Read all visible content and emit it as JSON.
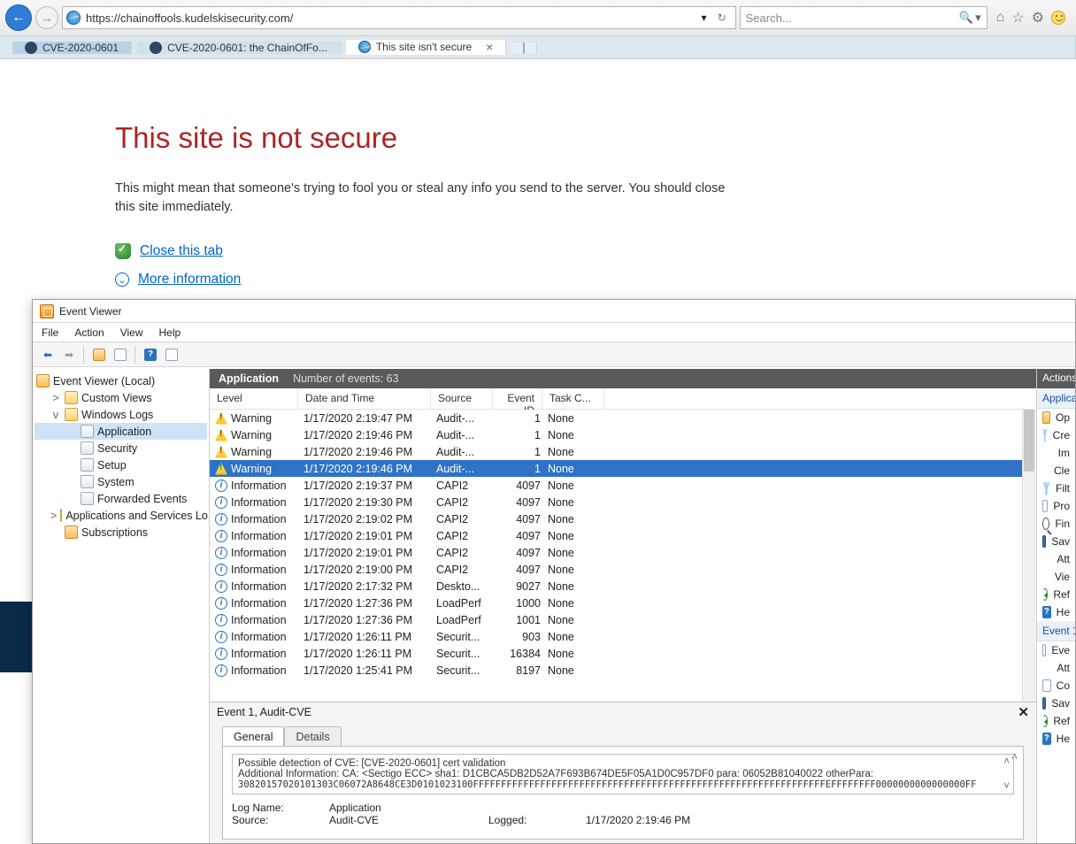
{
  "browser": {
    "url": "https://chainoffools.kudelskisecurity.com/",
    "refresh_glyph": "↻",
    "dropdown_glyph": "▾",
    "search_placeholder": "Search...",
    "search_icon": "🔍",
    "tabs": [
      {
        "label": "CVE-2020-0601",
        "active": false
      },
      {
        "label": "CVE-2020-0601: the ChainOfFo...",
        "active": false
      },
      {
        "label": "This site isn't secure",
        "active": true
      }
    ]
  },
  "error_page": {
    "title": "This site is not secure",
    "message": "This might mean that someone's trying to fool you or steal any info you send to the server. You should close this site immediately.",
    "close_link": "Close this tab",
    "more_link": "More information"
  },
  "event_viewer": {
    "window_title": "Event Viewer",
    "menu": [
      "File",
      "Action",
      "View",
      "Help"
    ],
    "tree": {
      "root": "Event Viewer (Local)",
      "items": [
        {
          "label": "Custom Views",
          "expand": ">",
          "indent": 1,
          "icon": "folder"
        },
        {
          "label": "Windows Logs",
          "expand": "v",
          "indent": 1,
          "icon": "folder"
        },
        {
          "label": "Application",
          "indent": 2,
          "icon": "log",
          "selected": true
        },
        {
          "label": "Security",
          "indent": 2,
          "icon": "log"
        },
        {
          "label": "Setup",
          "indent": 2,
          "icon": "log"
        },
        {
          "label": "System",
          "indent": 2,
          "icon": "log"
        },
        {
          "label": "Forwarded Events",
          "indent": 2,
          "icon": "log"
        },
        {
          "label": "Applications and Services Lo",
          "expand": ">",
          "indent": 1,
          "icon": "folder"
        },
        {
          "label": "Subscriptions",
          "indent": 1,
          "icon": "orange"
        }
      ]
    },
    "list": {
      "header_label": "Application",
      "count_label": "Number of events: 63",
      "columns": [
        "Level",
        "Date and Time",
        "Source",
        "Event ID",
        "Task C..."
      ],
      "rows": [
        {
          "level": "Warning",
          "icon": "warn",
          "dt": "1/17/2020 2:19:47 PM",
          "src": "Audit-...",
          "eid": "1",
          "tc": "None"
        },
        {
          "level": "Warning",
          "icon": "warn",
          "dt": "1/17/2020 2:19:46 PM",
          "src": "Audit-...",
          "eid": "1",
          "tc": "None"
        },
        {
          "level": "Warning",
          "icon": "warn",
          "dt": "1/17/2020 2:19:46 PM",
          "src": "Audit-...",
          "eid": "1",
          "tc": "None"
        },
        {
          "level": "Warning",
          "icon": "warn",
          "dt": "1/17/2020 2:19:46 PM",
          "src": "Audit-...",
          "eid": "1",
          "tc": "None",
          "selected": true
        },
        {
          "level": "Information",
          "icon": "info",
          "dt": "1/17/2020 2:19:37 PM",
          "src": "CAPI2",
          "eid": "4097",
          "tc": "None"
        },
        {
          "level": "Information",
          "icon": "info",
          "dt": "1/17/2020 2:19:30 PM",
          "src": "CAPI2",
          "eid": "4097",
          "tc": "None"
        },
        {
          "level": "Information",
          "icon": "info",
          "dt": "1/17/2020 2:19:02 PM",
          "src": "CAPI2",
          "eid": "4097",
          "tc": "None"
        },
        {
          "level": "Information",
          "icon": "info",
          "dt": "1/17/2020 2:19:01 PM",
          "src": "CAPI2",
          "eid": "4097",
          "tc": "None"
        },
        {
          "level": "Information",
          "icon": "info",
          "dt": "1/17/2020 2:19:01 PM",
          "src": "CAPI2",
          "eid": "4097",
          "tc": "None"
        },
        {
          "level": "Information",
          "icon": "info",
          "dt": "1/17/2020 2:19:00 PM",
          "src": "CAPI2",
          "eid": "4097",
          "tc": "None"
        },
        {
          "level": "Information",
          "icon": "info",
          "dt": "1/17/2020 2:17:32 PM",
          "src": "Deskto...",
          "eid": "9027",
          "tc": "None"
        },
        {
          "level": "Information",
          "icon": "info",
          "dt": "1/17/2020 1:27:36 PM",
          "src": "LoadPerf",
          "eid": "1000",
          "tc": "None"
        },
        {
          "level": "Information",
          "icon": "info",
          "dt": "1/17/2020 1:27:36 PM",
          "src": "LoadPerf",
          "eid": "1001",
          "tc": "None"
        },
        {
          "level": "Information",
          "icon": "info",
          "dt": "1/17/2020 1:26:11 PM",
          "src": "Securit...",
          "eid": "903",
          "tc": "None"
        },
        {
          "level": "Information",
          "icon": "info",
          "dt": "1/17/2020 1:26:11 PM",
          "src": "Securit...",
          "eid": "16384",
          "tc": "None"
        },
        {
          "level": "Information",
          "icon": "info",
          "dt": "1/17/2020 1:25:41 PM",
          "src": "Securit...",
          "eid": "8197",
          "tc": "None"
        }
      ]
    },
    "detail": {
      "title": "Event 1, Audit-CVE",
      "tabs": [
        "General",
        "Details"
      ],
      "description_l1": "Possible detection of CVE: [CVE-2020-0601] cert validation",
      "description_l2": "Additional Information: CA: <Sectigo ECC> sha1: D1CBCA5DB2D52A7F693B674DE5F05A1D0C957DF0 para: 06052B81040022 otherPara:",
      "description_l3": "30820157020101303C06072A8648CE3D0101023100FFFFFFFFFFFFFFFFFFFFFFFFFFFFFFFFFFFFFFFFFFFFFFFFFFFFFFFFFFFFFFFEFFFFFFFF0000000000000000FF",
      "log_name_label": "Log Name:",
      "log_name_value": "Application",
      "source_label": "Source:",
      "source_value": "Audit-CVE",
      "logged_label": "Logged:",
      "logged_value": "1/17/2020 2:19:46 PM"
    },
    "actions": {
      "header": "Actions",
      "section1": "Applica",
      "items1": [
        "Op",
        "Cre",
        "Im",
        "Cle",
        "Filt",
        "Pro",
        "Fin",
        "Sav",
        "Att",
        "Vie",
        "Ref",
        "He"
      ],
      "section2": "Event 1,",
      "items2": [
        "Eve",
        "Att",
        "Co",
        "Sav",
        "Ref",
        "He"
      ]
    }
  }
}
